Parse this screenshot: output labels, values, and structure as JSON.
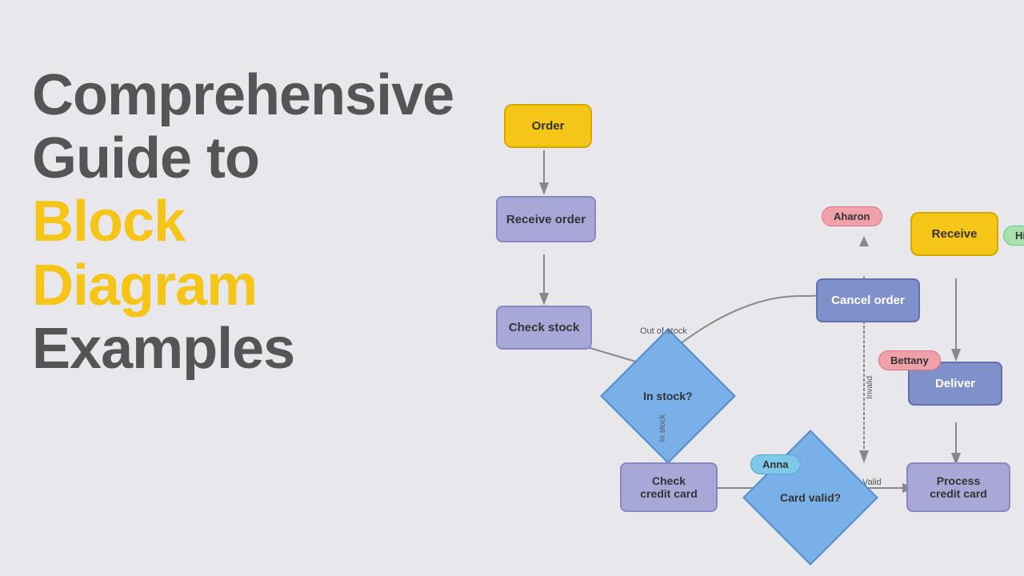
{
  "title": {
    "line1": "Comprehensive",
    "line2": "Guide to",
    "line3a": "Block Diagram",
    "line3b": "Examples"
  },
  "diagram": {
    "nodes": {
      "order": "Order",
      "receive_order": "Receive order",
      "check_stock": "Check stock",
      "in_stock": "In stock?",
      "cancel_order": "Cancel order",
      "check_credit": "Check\ncredit card",
      "card_valid": "Card\nvalid?",
      "process_credit": "Process\ncredit card",
      "receive": "Receive",
      "deliver": "Deliver"
    },
    "labels": {
      "out_of_stock": "Out of stock",
      "in_stock": "In stock",
      "invalid": "Invalid",
      "valid": "Valid"
    },
    "people": {
      "himali": "Himali",
      "aharon": "Aharon",
      "bettany": "Bettany",
      "anna": "Anna"
    }
  }
}
